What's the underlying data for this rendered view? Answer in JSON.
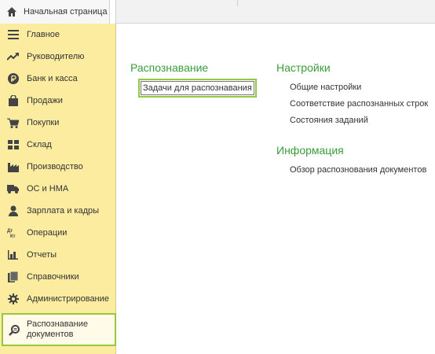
{
  "topbar": {
    "home_tab_label": "Начальная страница"
  },
  "sidebar": {
    "items": [
      {
        "label": "Главное",
        "icon": "menu-icon"
      },
      {
        "label": "Руководителю",
        "icon": "trend-up-icon"
      },
      {
        "label": "Банк и касса",
        "icon": "ruble-coin-icon"
      },
      {
        "label": "Продажи",
        "icon": "shopping-bag-icon"
      },
      {
        "label": "Покупки",
        "icon": "cart-icon"
      },
      {
        "label": "Склад",
        "icon": "warehouse-icon"
      },
      {
        "label": "Производство",
        "icon": "factory-icon"
      },
      {
        "label": "ОС и НМА",
        "icon": "truck-icon"
      },
      {
        "label": "Зарплата и кадры",
        "icon": "person-icon"
      },
      {
        "label": "Операции",
        "icon": "dt-kt-icon"
      },
      {
        "label": "Отчеты",
        "icon": "bar-chart-icon"
      },
      {
        "label": "Справочники",
        "icon": "books-icon"
      },
      {
        "label": "Администрирование",
        "icon": "gear-icon"
      },
      {
        "label": "Распознавание документов",
        "icon": "search-document-icon"
      }
    ],
    "dt_kt_glyph": {
      "top": "Дт",
      "bottom": "Кт"
    }
  },
  "main": {
    "recognition": {
      "title": "Распознавание",
      "links": [
        "Задачи для распознавания"
      ]
    },
    "settings": {
      "title": "Настройки",
      "links": [
        "Общие настройки",
        "Соответствие распознанных строк",
        "Состояния заданий"
      ]
    },
    "info": {
      "title": "Информация",
      "links": [
        "Обзор распознования документов"
      ]
    }
  },
  "colors": {
    "sidebar_bg": "#fbeca0",
    "accent_green": "#3a9d3a",
    "highlight_border": "#96c83e"
  }
}
